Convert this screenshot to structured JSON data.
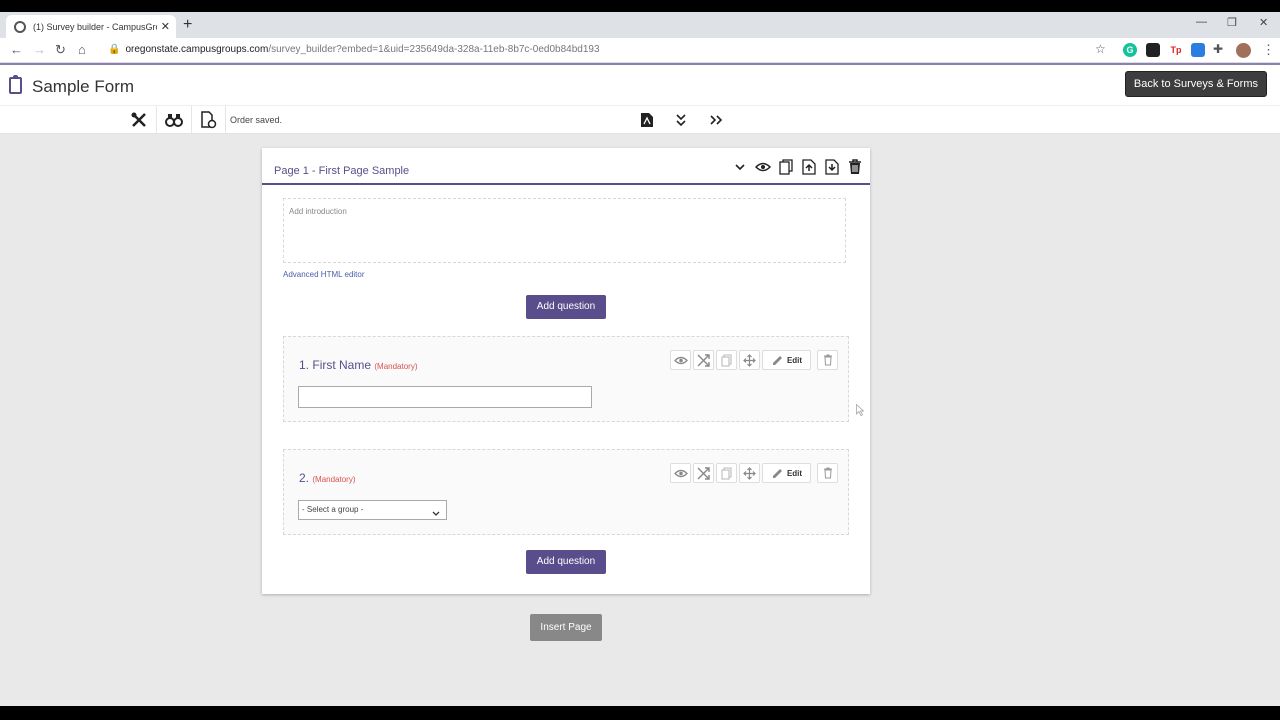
{
  "browser": {
    "tab_title": "(1) Survey builder - CampusGroups",
    "url_host": "oregonstate.campusgroups.com",
    "url_path": "/survey_builder?embed=1&uid=235649da-328a-11eb-8b7c-0ed0b84bd193",
    "extensions": [
      {
        "name": "grammarly-icon",
        "glyph": "G",
        "color": "#15c39a"
      },
      {
        "name": "shield-extension-icon",
        "glyph": "",
        "color": "#222222"
      },
      {
        "name": "tp-extension-icon",
        "glyph": "Tp",
        "color": "#e02020"
      },
      {
        "name": "grid-extension-icon",
        "glyph": "",
        "color": "#2a7de1"
      }
    ]
  },
  "header": {
    "form_title": "Sample Form",
    "back_button": "Back to Surveys & Forms"
  },
  "toolbar": {
    "status": "Order saved."
  },
  "page": {
    "title": "Page 1 - First Page Sample",
    "intro_placeholder": "Add introduction",
    "advanced_link": "Advanced HTML editor",
    "add_question": "Add question"
  },
  "questions": [
    {
      "number": "1.",
      "label": "First Name",
      "mandatory": "(Mandatory)",
      "edit": "Edit"
    },
    {
      "number": "2.",
      "label": "",
      "mandatory": "(Mandatory)",
      "edit": "Edit",
      "select_value": "- Select a group -"
    }
  ],
  "insert_page": "Insert Page",
  "colors": {
    "accent": "#5a4d8c",
    "mandatory": "#d9534f"
  }
}
